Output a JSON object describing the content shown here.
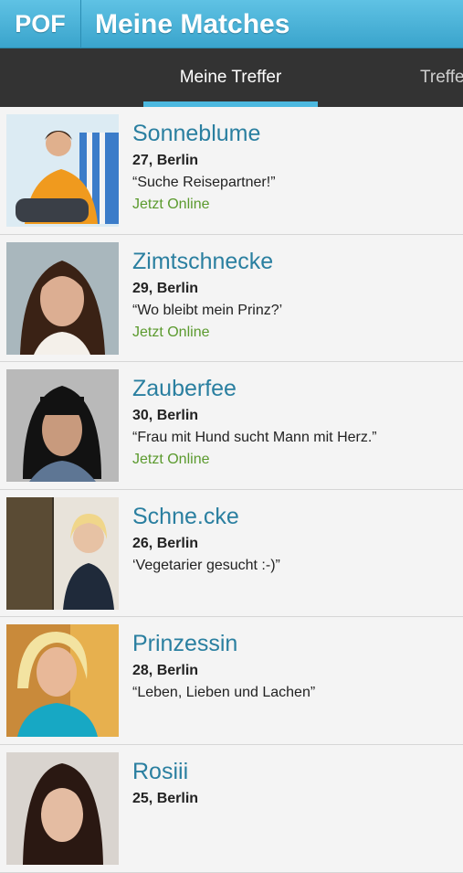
{
  "appbar": {
    "logo": "POF",
    "title": "Meine Matches"
  },
  "tabs": [
    {
      "label": "Meine Treffer",
      "active": true
    },
    {
      "label": "Treffer",
      "active": false
    }
  ],
  "colors": {
    "appbar": "#3aa4cc",
    "tab_indicator": "#4cb8df",
    "name": "#2a7fa0",
    "online": "#5b9a2e"
  },
  "matches": [
    {
      "name": "Sonneblume",
      "meta": "27, Berlin",
      "quote": "“Suche Reisepartner!”",
      "status": "Jetzt Online"
    },
    {
      "name": "Zimtschnecke",
      "meta": "29, Berlin",
      "quote": "“Wo bleibt mein Prinz?’",
      "status": "Jetzt Online"
    },
    {
      "name": "Zauberfee",
      "meta": "30, Berlin",
      "quote": "“Frau mit Hund sucht Mann mit Herz.”",
      "status": "Jetzt Online"
    },
    {
      "name": "Schne.cke",
      "meta": "26, Berlin",
      "quote": "‘Vegetarier gesucht :-)”",
      "status": ""
    },
    {
      "name": "Prinzessin",
      "meta": "28, Berlin",
      "quote": "“Leben, Lieben und Lachen”",
      "status": ""
    },
    {
      "name": "Rosiii",
      "meta": "25, Berlin",
      "quote": "",
      "status": ""
    }
  ]
}
